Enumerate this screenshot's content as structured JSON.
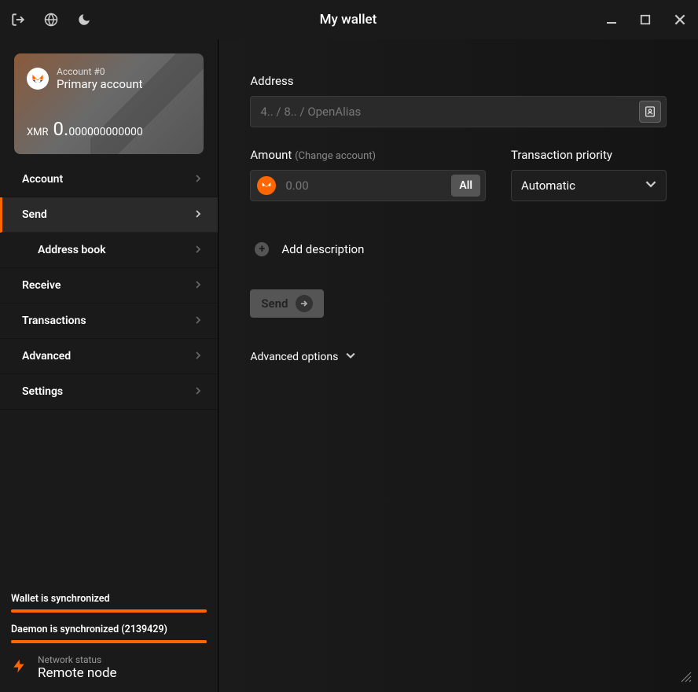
{
  "titlebar": {
    "title": "My wallet"
  },
  "account": {
    "number": "Account #0",
    "name": "Primary account",
    "ticker": "XMR",
    "balance_whole": "0.",
    "balance_frac": "000000000000"
  },
  "nav": {
    "items": [
      {
        "label": "Account"
      },
      {
        "label": "Send"
      },
      {
        "label": "Address book"
      },
      {
        "label": "Receive"
      },
      {
        "label": "Transactions"
      },
      {
        "label": "Advanced"
      },
      {
        "label": "Settings"
      }
    ]
  },
  "status": {
    "wallet": "Wallet is synchronized",
    "daemon": "Daemon is synchronized (2139429)",
    "network_label": "Network status",
    "network_value": "Remote node"
  },
  "send": {
    "address_label": "Address",
    "address_placeholder": "4.. / 8.. / OpenAlias",
    "amount_label": "Amount",
    "amount_sublabel": "(Change account)",
    "amount_placeholder": "0.00",
    "all_button": "All",
    "priority_label": "Transaction priority",
    "priority_value": "Automatic",
    "add_description": "Add description",
    "send_button": "Send",
    "advanced_options": "Advanced options"
  }
}
